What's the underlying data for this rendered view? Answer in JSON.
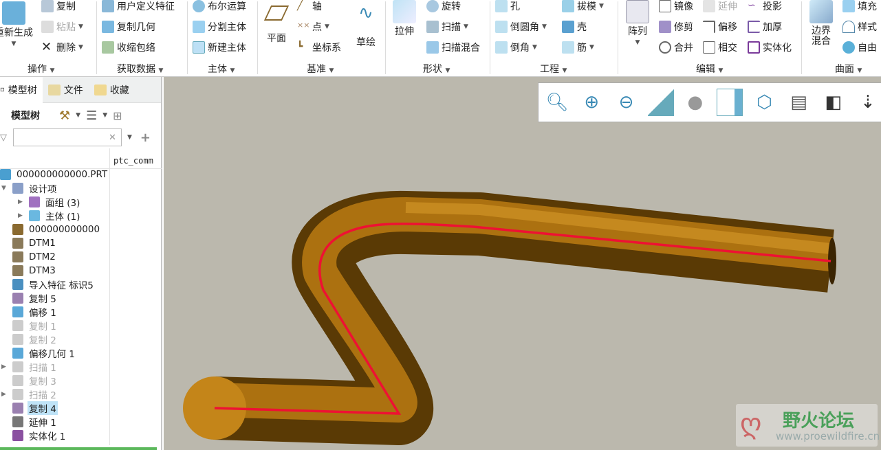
{
  "ribbon": {
    "groups": {
      "ops": "操作",
      "getdata": "获取数据",
      "body": "主体",
      "datum": "基准",
      "shape": "形状",
      "eng": "工程",
      "edit": "编辑",
      "surface": "曲面"
    },
    "ops": {
      "regen": "重新生成",
      "copy": "复制",
      "paste": "粘贴",
      "delete": "删除"
    },
    "getdata": {
      "udf": "用户定义特征",
      "copygeom": "复制几何",
      "shrinkwrap": "收缩包络"
    },
    "body": {
      "boolean": "布尔运算",
      "split": "分割主体",
      "newbody": "新建主体"
    },
    "datum": {
      "plane": "平面",
      "axis": "轴",
      "point": "点",
      "csys": "坐标系",
      "sketch": "草绘"
    },
    "shape": {
      "extrude": "拉伸",
      "revolve": "旋转",
      "sweep": "扫描",
      "sweptblend": "扫描混合"
    },
    "eng": {
      "hole": "孔",
      "round": "倒圆角",
      "chamfer": "倒角",
      "draft": "拔模",
      "shell": "壳",
      "rib": "筋"
    },
    "edit": {
      "pattern": "阵列",
      "mirror": "镜像",
      "trim": "修剪",
      "merge": "合并",
      "extend": "延伸",
      "offset": "偏移",
      "intersect": "相交",
      "project": "投影",
      "thicken": "加厚",
      "solidify": "实体化"
    },
    "surface": {
      "boundary1": "边界",
      "boundary2": "混合",
      "fill": "填充",
      "style": "样式",
      "freestyle": "自由"
    }
  },
  "left": {
    "tabs": [
      "模型树",
      "文件",
      "收藏"
    ],
    "title": "模型树",
    "filter_value": "",
    "column": "ptc_comm",
    "tree": [
      {
        "label": "000000000000.PRT",
        "icon": "part",
        "color": "#4a9fd0",
        "lvl": 0,
        "state": "normal"
      },
      {
        "label": "设计项",
        "icon": "design-items",
        "color": "#8a9fc8",
        "lvl": 1,
        "exp": "down",
        "state": "normal"
      },
      {
        "label": "面组 (3)",
        "icon": "quilt",
        "color": "#a070c0",
        "lvl": 2,
        "exp": "right",
        "state": "normal"
      },
      {
        "label": "主体 (1)",
        "icon": "body",
        "color": "#6ab8e0",
        "lvl": 2,
        "exp": "right",
        "state": "normal"
      },
      {
        "label": "000000000000",
        "icon": "csys",
        "color": "#8a6a30",
        "lvl": 1,
        "state": "normal"
      },
      {
        "label": "DTM1",
        "icon": "datum-plane",
        "color": "#8a7a5a",
        "lvl": 1,
        "state": "normal"
      },
      {
        "label": "DTM2",
        "icon": "datum-plane",
        "color": "#8a7a5a",
        "lvl": 1,
        "state": "normal"
      },
      {
        "label": "DTM3",
        "icon": "datum-plane",
        "color": "#8a7a5a",
        "lvl": 1,
        "state": "normal"
      },
      {
        "label": "导入特征 标识5",
        "icon": "import",
        "color": "#4a8fc0",
        "lvl": 1,
        "state": "normal"
      },
      {
        "label": "复制 5",
        "icon": "copy",
        "color": "#9a80b0",
        "lvl": 1,
        "state": "normal"
      },
      {
        "label": "偏移 1",
        "icon": "offset",
        "color": "#5aa8d8",
        "lvl": 1,
        "state": "normal"
      },
      {
        "label": "复制 1",
        "icon": "copy",
        "color": "#ccc",
        "lvl": 1,
        "state": "disabled"
      },
      {
        "label": "复制 2",
        "icon": "copy",
        "color": "#ccc",
        "lvl": 1,
        "state": "disabled"
      },
      {
        "label": "偏移几何 1",
        "icon": "offset-geom",
        "color": "#5aa8d8",
        "lvl": 1,
        "state": "normal"
      },
      {
        "label": "扫描 1",
        "icon": "sweep",
        "color": "#ccc",
        "lvl": 1,
        "exp": "right",
        "state": "disabled"
      },
      {
        "label": "复制 3",
        "icon": "copy",
        "color": "#ccc",
        "lvl": 1,
        "state": "disabled"
      },
      {
        "label": "扫描 2",
        "icon": "sweep",
        "color": "#ccc",
        "lvl": 1,
        "exp": "right",
        "state": "disabled"
      },
      {
        "label": "复制 4",
        "icon": "copy",
        "color": "#9a80b0",
        "lvl": 1,
        "state": "selected"
      },
      {
        "label": "延伸 1",
        "icon": "extend",
        "color": "#777",
        "lvl": 1,
        "state": "normal"
      },
      {
        "label": "实体化 1",
        "icon": "solidify",
        "color": "#8a50a0",
        "lvl": 1,
        "state": "normal"
      }
    ]
  },
  "watermark": {
    "name": "野火论坛",
    "url": "www.proewildfire.cn"
  },
  "colors": {
    "pipe": "#a9700f",
    "pipe_dark": "#5a3a05",
    "curve": "#ee1133",
    "viewport": "#bbb8ad"
  }
}
